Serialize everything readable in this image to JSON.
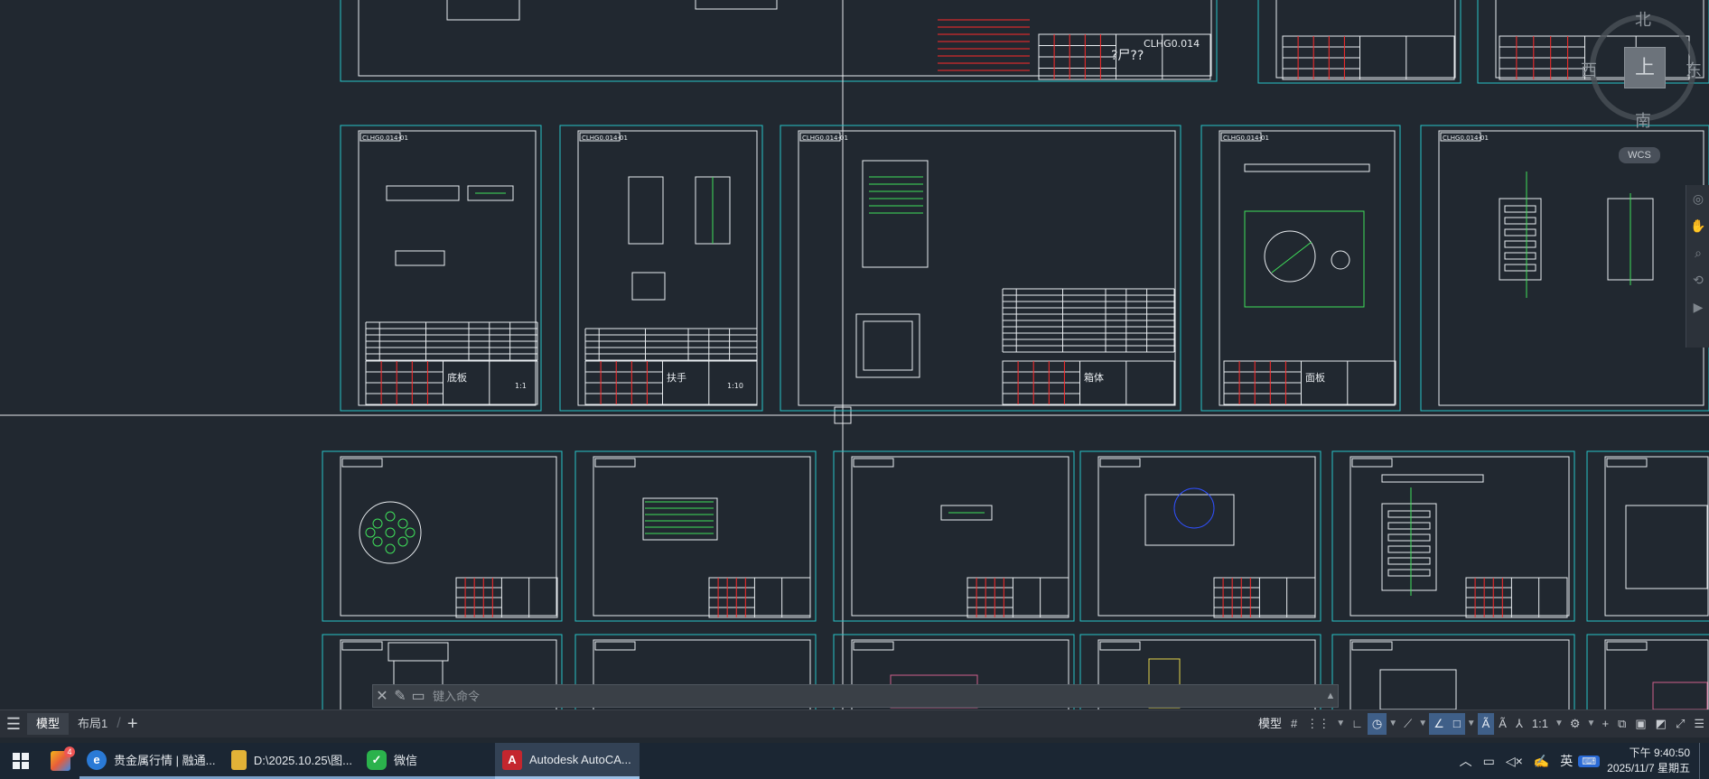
{
  "viewcube": {
    "face": "上",
    "north": "北",
    "south": "南",
    "west": "西",
    "east": "东",
    "wcs": "WCS"
  },
  "drawing_labels": {
    "part_title_1": "底板",
    "part_title_2": "扶手",
    "part_title_3": "箱体",
    "part_title_4": "面板",
    "part_code_top": "CLHG0.014",
    "scale_a": "1:1",
    "scale_b": "1:10",
    "header_tag": "CLHG0.014-01"
  },
  "command": {
    "placeholder": "键入命令"
  },
  "layout": {
    "tabs": [
      "模型",
      "布局1"
    ],
    "active": "模型"
  },
  "status": {
    "model": "模型",
    "scale": "1:1"
  },
  "taskbar": {
    "apps": [
      {
        "label": "贵金属行情 | 融通...",
        "color": "#2a7ad6",
        "glyph": "e"
      },
      {
        "label": "D:\\2025.10.25\\图...",
        "color": "#e2b237",
        "glyph": ""
      },
      {
        "label": "微信",
        "color": "#2bb24c",
        "glyph": "✓"
      },
      {
        "label": "Autodesk AutoCA...",
        "color": "#c4262e",
        "glyph": "A"
      }
    ],
    "store_badge": "4",
    "ime": "英",
    "time": "下午 9:40:50",
    "date": "2025/11/7 星期五"
  },
  "colors": {
    "canvas": "#212830",
    "frame": "#27c3c8",
    "linework": "#e8ecef",
    "annotation_red": "#ff2a2a",
    "green": "#3fe05a",
    "yellow": "#e2d34a"
  }
}
